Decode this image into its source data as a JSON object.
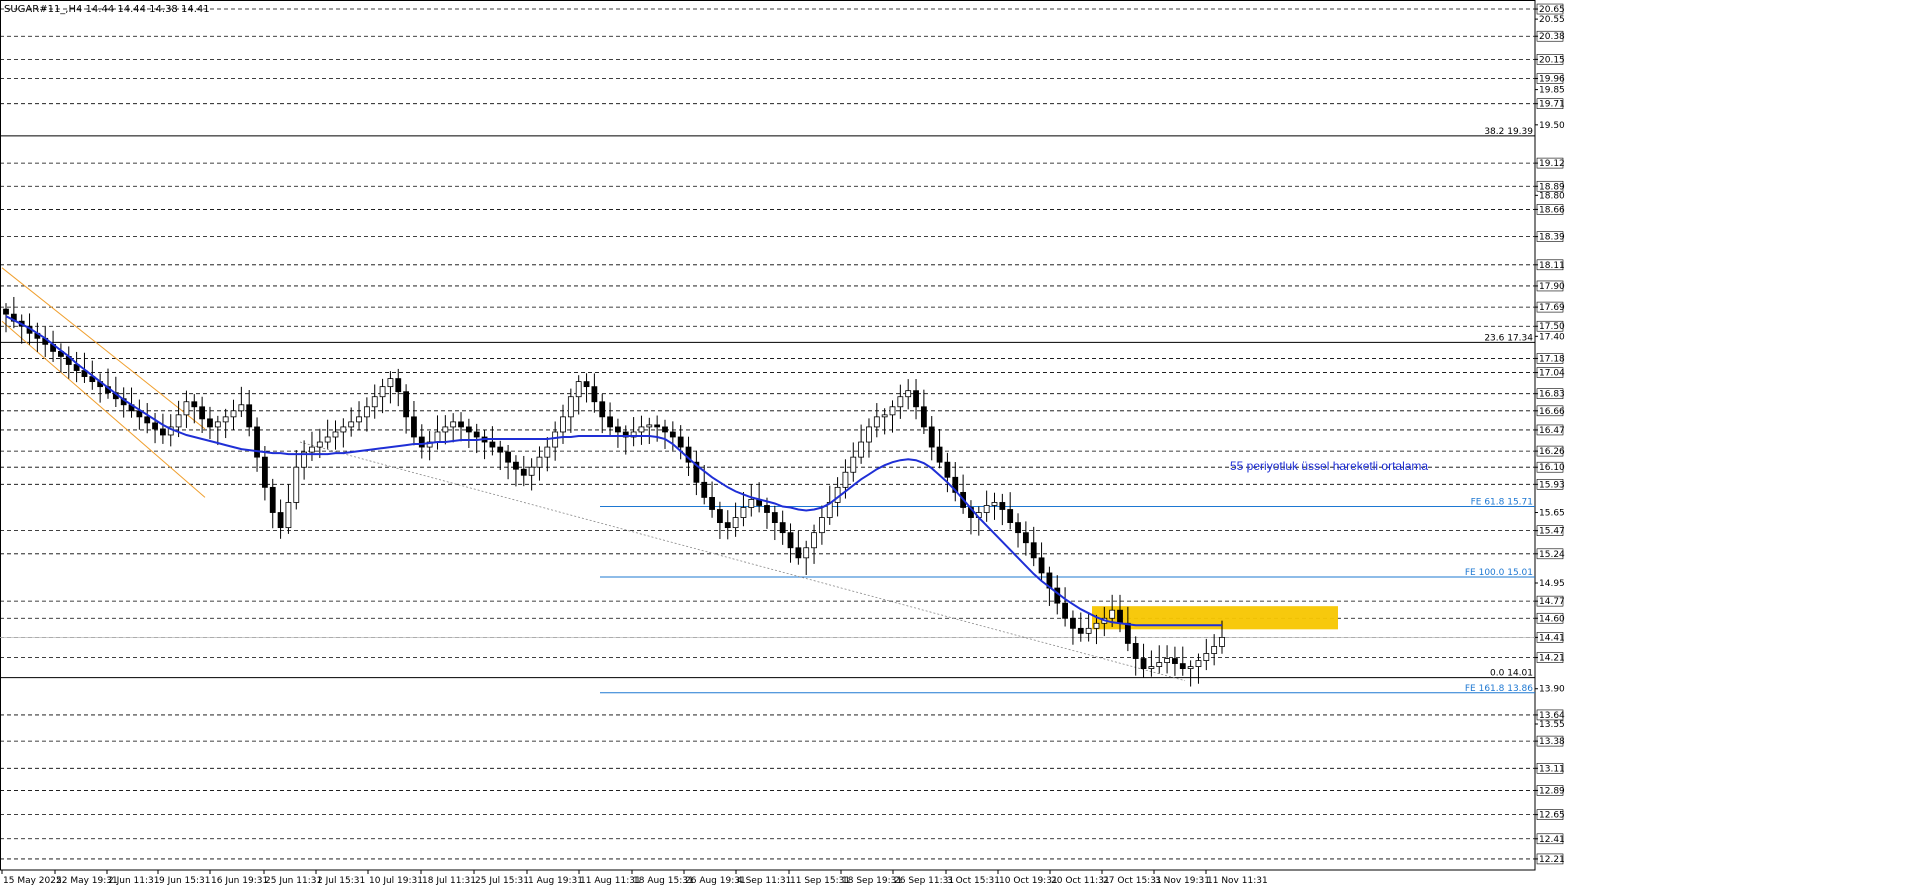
{
  "header": {
    "symbol": "SUGAR#11_,H4",
    "ohlc": "14.44 14.44 14.38 14.41"
  },
  "colors": {
    "candle_up": "#000000",
    "candle_down": "#000000",
    "ema": "#1f2fd6",
    "channel": "#f0a030",
    "fib_line": "#1e78d2",
    "zone": "#f7c600",
    "grid": "#000000",
    "trend": "#888888"
  },
  "annotation": {
    "ema_label": "55 periyotluk üssel hareketli ortalama"
  },
  "chart_data": {
    "type": "candlestick",
    "ylim": [
      12.1,
      20.7
    ],
    "grid": "horizontal dashed",
    "y_ticks": [
      "20.65",
      "20.55",
      "20.38",
      "20.15",
      "19.96",
      "19.85",
      "19.71",
      "19.50",
      "19.12",
      "18.89",
      "18.80",
      "18.66",
      "18.39",
      "18.11",
      "17.90",
      "17.69",
      "17.50",
      "17.40",
      "17.18",
      "17.04",
      "16.83",
      "16.66",
      "16.47",
      "16.26",
      "16.10",
      "15.93",
      "15.65",
      "15.47",
      "15.24",
      "14.95",
      "14.77",
      "14.60",
      "14.41",
      "14.21",
      "13.90",
      "13.64",
      "13.55",
      "13.38",
      "13.11",
      "12.89",
      "12.65",
      "12.41",
      "12.21"
    ],
    "y_tick_values": [
      20.65,
      20.55,
      20.38,
      20.15,
      19.96,
      19.85,
      19.71,
      19.5,
      19.12,
      18.89,
      18.8,
      18.66,
      18.39,
      18.11,
      17.9,
      17.69,
      17.5,
      17.4,
      17.18,
      17.04,
      16.83,
      16.66,
      16.47,
      16.26,
      16.1,
      15.93,
      15.65,
      15.47,
      15.24,
      14.95,
      14.77,
      14.6,
      14.41,
      14.21,
      13.9,
      13.64,
      13.55,
      13.38,
      13.11,
      12.89,
      12.65,
      12.41,
      12.21
    ],
    "highlighted_ticks": [
      20.65,
      20.38,
      20.15,
      19.96,
      19.71,
      19.12,
      18.89,
      18.66,
      18.39,
      18.11,
      17.9,
      17.69,
      17.5,
      17.18,
      17.04,
      16.83,
      16.66,
      16.47,
      16.26,
      16.1,
      15.93,
      15.47,
      15.24,
      14.77,
      14.6,
      14.41,
      14.21,
      13.64,
      13.38,
      13.11,
      12.89,
      12.65,
      12.41,
      12.21
    ],
    "x_ticks": [
      "15 May 2025",
      "22 May 19:31",
      "2 Jun 11:31",
      "9 Jun 15:31",
      "16 Jun 19:31",
      "25 Jun 11:31",
      "2 Jul 15:31",
      "10 Jul 19:31",
      "18 Jul 11:31",
      "25 Jul 15:31",
      "1 Aug 19:31",
      "11 Aug 11:31",
      "18 Aug 15:31",
      "26 Aug 19:31",
      "4 Sep 11:31",
      "11 Sep 15:31",
      "18 Sep 19:31",
      "26 Sep 11:31",
      "3 Oct 15:31",
      "10 Oct 19:31",
      "20 Oct 11:31",
      "27 Oct 15:31",
      "3 Nov 19:31",
      "11 Nov 11:31"
    ],
    "fib_levels": [
      {
        "label": "38.2 19.39",
        "value": 19.39,
        "style": "solid-black"
      },
      {
        "label": "23.6 17.34",
        "value": 17.34,
        "style": "solid-black"
      },
      {
        "label": "0.0 14.01",
        "value": 14.01,
        "style": "solid-black"
      },
      {
        "label": "FE 61.8 15.71",
        "value": 15.71,
        "style": "blue"
      },
      {
        "label": "FE 100.0 15.01",
        "value": 15.01,
        "style": "blue"
      },
      {
        "label": "FE 161.8 13.86",
        "value": 13.86,
        "style": "blue"
      }
    ],
    "current_price": 14.41,
    "zone": {
      "low": 14.49,
      "high": 14.72
    },
    "closes": [
      17.62,
      17.55,
      17.5,
      17.43,
      17.38,
      17.32,
      17.25,
      17.2,
      17.12,
      17.06,
      17.0,
      16.95,
      16.9,
      16.84,
      16.78,
      16.72,
      16.66,
      16.6,
      16.54,
      16.48,
      16.42,
      16.5,
      16.62,
      16.75,
      16.7,
      16.58,
      16.5,
      16.55,
      16.6,
      16.66,
      16.72,
      16.5,
      16.2,
      15.9,
      15.65,
      15.5,
      15.75,
      16.1,
      16.25,
      16.3,
      16.35,
      16.4,
      16.45,
      16.5,
      16.55,
      16.6,
      16.7,
      16.8,
      16.9,
      16.98,
      16.85,
      16.6,
      16.4,
      16.3,
      16.35,
      16.45,
      16.5,
      16.55,
      16.5,
      16.45,
      16.4,
      16.35,
      16.3,
      16.25,
      16.15,
      16.08,
      16.02,
      16.1,
      16.2,
      16.3,
      16.45,
      16.6,
      16.8,
      16.95,
      16.9,
      16.75,
      16.6,
      16.5,
      16.45,
      16.4,
      16.45,
      16.5,
      16.52,
      16.5,
      16.45,
      16.4,
      16.3,
      16.15,
      15.95,
      15.8,
      15.68,
      15.55,
      15.5,
      15.6,
      15.7,
      15.78,
      15.72,
      15.65,
      15.55,
      15.45,
      15.3,
      15.2,
      15.3,
      15.45,
      15.6,
      15.75,
      15.9,
      16.05,
      16.2,
      16.35,
      16.5,
      16.6,
      16.62,
      16.7,
      16.8,
      16.86,
      16.7,
      16.5,
      16.3,
      16.15,
      16.0,
      15.85,
      15.7,
      15.6,
      15.65,
      15.72,
      15.75,
      15.68,
      15.55,
      15.45,
      15.35,
      15.2,
      15.05,
      14.9,
      14.75,
      14.6,
      14.5,
      14.45,
      14.5,
      14.55,
      14.6,
      14.68,
      14.55,
      14.35,
      14.2,
      14.1,
      14.12,
      14.16,
      14.2,
      14.15,
      14.1,
      14.12,
      14.18,
      14.25,
      14.32,
      14.41
    ],
    "ema_55": [
      17.6,
      17.56,
      17.52,
      17.48,
      17.43,
      17.38,
      17.32,
      17.26,
      17.2,
      17.13,
      17.07,
      17.01,
      16.95,
      16.89,
      16.83,
      16.77,
      16.72,
      16.67,
      16.62,
      16.57,
      16.52,
      16.48,
      16.45,
      16.42,
      16.4,
      16.38,
      16.36,
      16.34,
      16.32,
      16.3,
      16.28,
      16.27,
      16.26,
      16.25,
      16.24,
      16.24,
      16.23,
      16.23,
      16.23,
      16.23,
      16.23,
      16.23,
      16.24,
      16.24,
      16.25,
      16.26,
      16.27,
      16.28,
      16.29,
      16.3,
      16.31,
      16.32,
      16.33,
      16.33,
      16.34,
      16.35,
      16.35,
      16.36,
      16.37,
      16.37,
      16.37,
      16.38,
      16.38,
      16.38,
      16.38,
      16.38,
      16.38,
      16.38,
      16.38,
      16.38,
      16.39,
      16.4,
      16.4,
      16.41,
      16.41,
      16.41,
      16.41,
      16.41,
      16.41,
      16.41,
      16.41,
      16.41,
      16.41,
      16.4,
      16.38,
      16.33,
      16.26,
      16.19,
      16.12,
      16.06,
      16.0,
      15.95,
      15.9,
      15.86,
      15.83,
      15.8,
      15.78,
      15.76,
      15.74,
      15.71,
      15.7,
      15.68,
      15.67,
      15.68,
      15.7,
      15.74,
      15.8,
      15.86,
      15.92,
      15.98,
      16.03,
      16.08,
      16.12,
      16.15,
      16.17,
      16.18,
      16.17,
      16.14,
      16.09,
      16.02,
      15.95,
      15.87,
      15.78,
      15.69,
      15.6,
      15.52,
      15.44,
      15.36,
      15.28,
      15.2,
      15.12,
      15.04,
      14.97,
      14.91,
      14.85,
      14.79,
      14.74,
      14.69,
      14.65,
      14.61,
      14.58,
      14.56,
      14.55,
      14.54,
      14.53,
      14.53,
      14.53,
      14.53,
      14.53,
      14.53,
      14.53,
      14.53,
      14.53,
      14.53,
      14.53,
      14.53
    ]
  }
}
